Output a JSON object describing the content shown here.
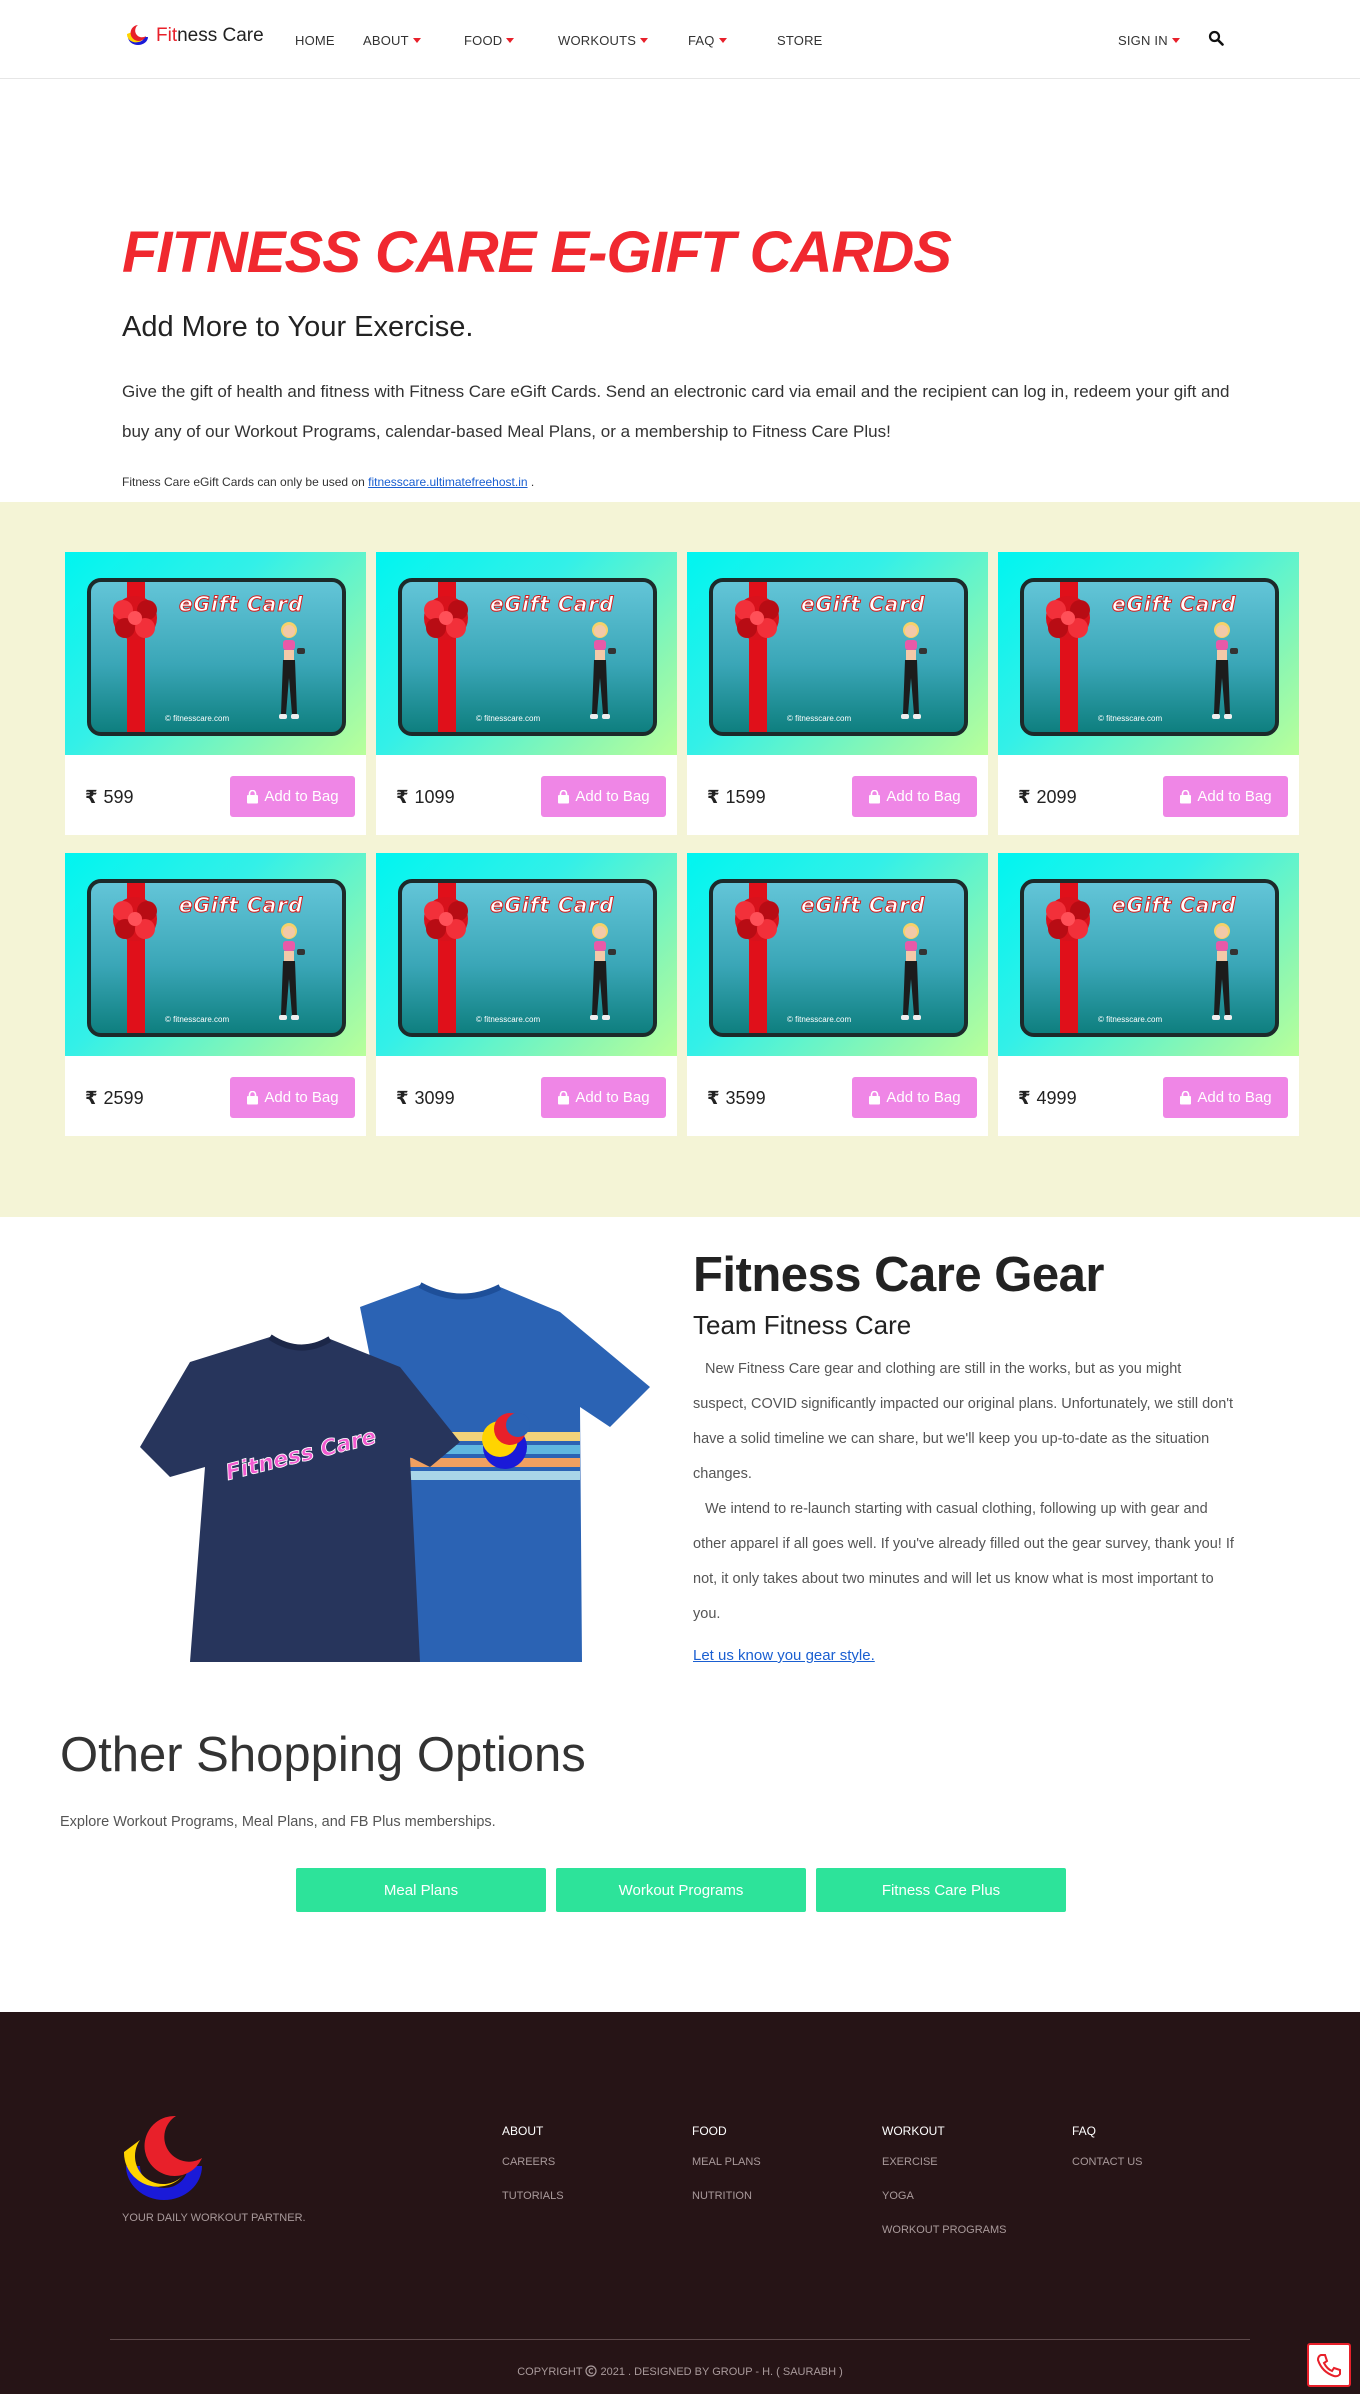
{
  "brand": {
    "name_part1": "Fit",
    "name_part2": "ness Care"
  },
  "nav": {
    "home": "HOME",
    "about": "ABOUT",
    "food": "FOOD",
    "workouts": "WORKOUTS",
    "faq": "FAQ",
    "store": "STORE",
    "sign_in": "SIGN IN"
  },
  "hero": {
    "title": "FITNESS CARE E-GIFT CARDS",
    "subtitle": "Add More to Your Exercise.",
    "lead": "Give the gift of health and fitness with Fitness Care eGift Cards. Send an electronic card via email and the recipient can log in, redeem your gift and buy any of our Workout Programs, calendar-based Meal Plans, or a membership to Fitness Care Plus!",
    "note_prefix": "Fitness Care eGift Cards can only be used on ",
    "note_link": "fitnesscare.ultimatefreehost.in",
    "note_suffix": " ."
  },
  "gift_cards": {
    "card_title": "eGift Card",
    "card_credit": "© fitnesscare.com",
    "currency_symbol": "₹",
    "button_label": "Add to Bag",
    "items": [
      {
        "price": "599"
      },
      {
        "price": "1099"
      },
      {
        "price": "1599"
      },
      {
        "price": "2099"
      },
      {
        "price": "2599"
      },
      {
        "price": "3099"
      },
      {
        "price": "3599"
      },
      {
        "price": "4999"
      }
    ]
  },
  "gear": {
    "title": "Fitness Care Gear",
    "subtitle": "Team Fitness Care",
    "para1": "New Fitness Care gear and clothing are still in the works, but as you might suspect, COVID significantly impacted our original plans. Unfortunately, we still don't have a solid timeline we can share, but we'll keep you up-to-date as the situation changes.",
    "para2": "We intend to re-launch starting with casual clothing, following up with gear and other apparel if all goes well. If you've already filled out the gear survey, thank you! If not, it only takes about two minutes and will let us know what is most important to you.",
    "link": "Let us know you gear style.",
    "shirt_print": "Fitness Care"
  },
  "other": {
    "title": "Other Shopping Options",
    "desc": "Explore Workout Programs, Meal Plans, and FB Plus memberships.",
    "buttons": [
      "Meal Plans",
      "Workout Programs",
      "Fitness Care Plus"
    ]
  },
  "footer": {
    "tagline": "YOUR DAILY WORKOUT PARTNER.",
    "columns": [
      {
        "head": "ABOUT",
        "links": [
          "CAREERS",
          "TUTORIALS"
        ]
      },
      {
        "head": "FOOD",
        "links": [
          "MEAL PLANS",
          "NUTRITION"
        ]
      },
      {
        "head": "WORKOUT",
        "links": [
          "EXERCISE",
          "YOGA",
          "WORKOUT PROGRAMS"
        ]
      },
      {
        "head": "FAQ",
        "links": [
          "CONTACT US"
        ]
      }
    ],
    "copyright_prefix": "COPYRIGHT",
    "copyright_rest": "2021 . DESIGNED BY GROUP - H. ( SAURABH )"
  },
  "colors": {
    "brand_red": "#e8202a",
    "button_pink": "#ef86e6",
    "button_green": "#2de39a",
    "gift_bg": "#f4f4d6",
    "footer_bg": "#261416"
  }
}
